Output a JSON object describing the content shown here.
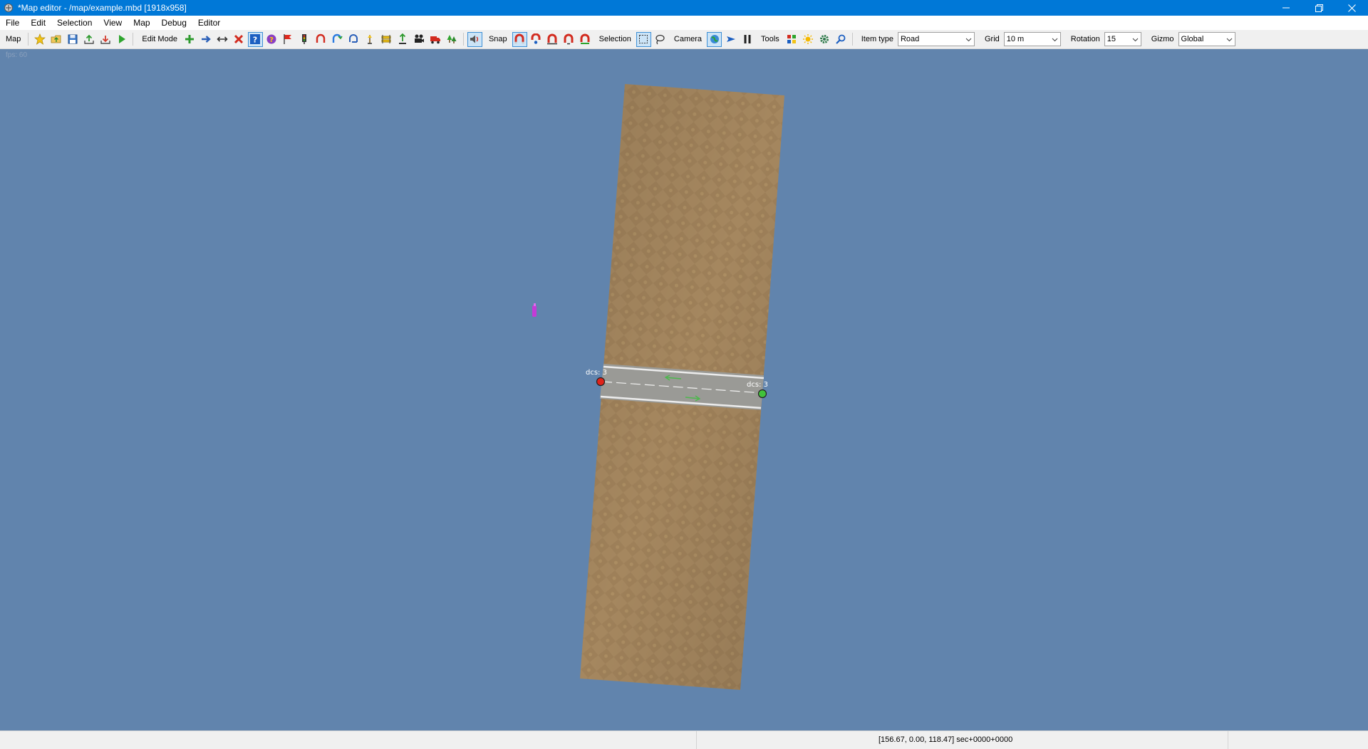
{
  "window": {
    "title": "*Map editor - /map/example.mbd [1918x958]"
  },
  "menu": [
    "File",
    "Edit",
    "Selection",
    "View",
    "Map",
    "Debug",
    "Editor"
  ],
  "toolbar": {
    "map_label": "Map",
    "edit_mode_label": "Edit Mode",
    "snap_label": "Snap",
    "selection_label": "Selection",
    "camera_label": "Camera",
    "tools_label": "Tools",
    "item_type_label": "Item type",
    "item_type_value": "Road",
    "grid_label": "Grid",
    "grid_value": "10 m",
    "rotation_label": "Rotation",
    "rotation_value": "15",
    "gizmo_label": "Gizmo",
    "gizmo_value": "Global"
  },
  "viewport": {
    "fps_text": "fps: 60",
    "node_left_label": "dcs: 3",
    "node_right_label": "dcs: 3",
    "colors": {
      "sky": "#6184ad",
      "terrain": "#a5875f",
      "road": "#9a9a96",
      "node_start": "#e0231a",
      "node_end": "#41c23a",
      "marker": "#c43bd6"
    }
  },
  "status": {
    "coords": "[156.67, 0.00, 118.47] sec+0000+0000"
  }
}
